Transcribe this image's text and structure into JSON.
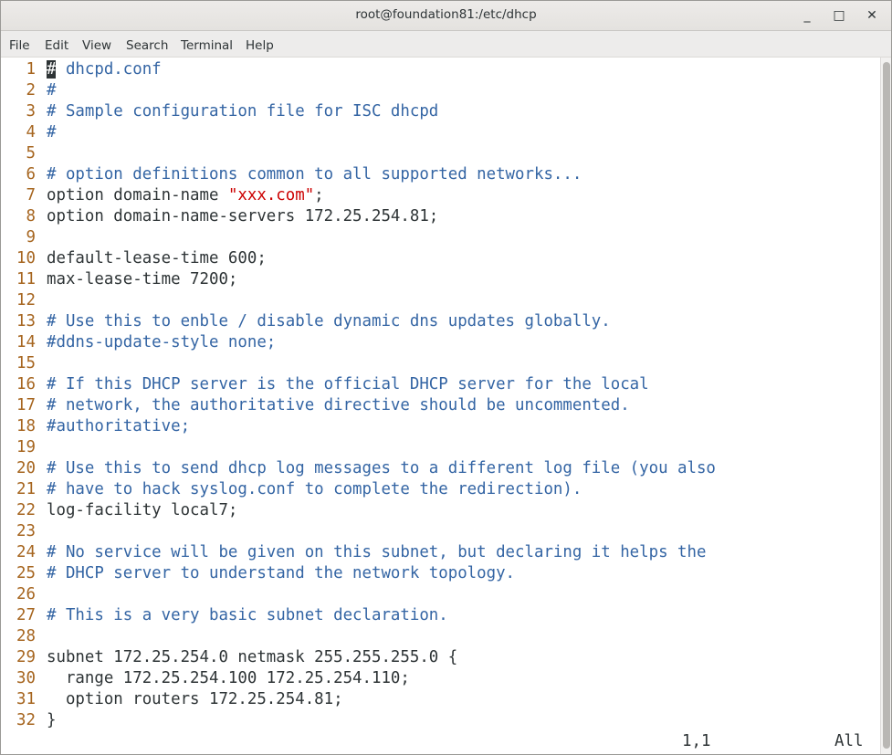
{
  "window": {
    "title": "root@foundation81:/etc/dhcp"
  },
  "window_controls": {
    "minimize": "_",
    "maximize": "□",
    "close": "✕"
  },
  "menu": [
    "File",
    "Edit",
    "View",
    "Search",
    "Terminal",
    "Help"
  ],
  "editor": {
    "lines": [
      {
        "n": "1",
        "t": "c",
        "text": "# dhcpd.conf"
      },
      {
        "n": "2",
        "t": "c",
        "text": "#"
      },
      {
        "n": "3",
        "t": "c",
        "text": "# Sample configuration file for ISC dhcpd"
      },
      {
        "n": "4",
        "t": "c",
        "text": "#"
      },
      {
        "n": "5",
        "t": "n",
        "text": ""
      },
      {
        "n": "6",
        "t": "c",
        "text": "# option definitions common to all supported networks..."
      },
      {
        "n": "7",
        "t": "s",
        "text": "option domain-name ",
        "str": "\"xxx.com\"",
        "after": ";"
      },
      {
        "n": "8",
        "t": "n",
        "text": "option domain-name-servers 172.25.254.81;"
      },
      {
        "n": "9",
        "t": "n",
        "text": ""
      },
      {
        "n": "10",
        "t": "n",
        "text": "default-lease-time 600;"
      },
      {
        "n": "11",
        "t": "n",
        "text": "max-lease-time 7200;"
      },
      {
        "n": "12",
        "t": "n",
        "text": ""
      },
      {
        "n": "13",
        "t": "c",
        "text": "# Use this to enble / disable dynamic dns updates globally."
      },
      {
        "n": "14",
        "t": "c",
        "text": "#ddns-update-style none;"
      },
      {
        "n": "15",
        "t": "n",
        "text": ""
      },
      {
        "n": "16",
        "t": "c",
        "text": "# If this DHCP server is the official DHCP server for the local"
      },
      {
        "n": "17",
        "t": "c",
        "text": "# network, the authoritative directive should be uncommented."
      },
      {
        "n": "18",
        "t": "c",
        "text": "#authoritative;"
      },
      {
        "n": "19",
        "t": "n",
        "text": ""
      },
      {
        "n": "20",
        "t": "c",
        "text": "# Use this to send dhcp log messages to a different log file (you also"
      },
      {
        "n": "21",
        "t": "c",
        "text": "# have to hack syslog.conf to complete the redirection)."
      },
      {
        "n": "22",
        "t": "n",
        "text": "log-facility local7;"
      },
      {
        "n": "23",
        "t": "n",
        "text": ""
      },
      {
        "n": "24",
        "t": "c",
        "text": "# No service will be given on this subnet, but declaring it helps the"
      },
      {
        "n": "25",
        "t": "c",
        "text": "# DHCP server to understand the network topology."
      },
      {
        "n": "26",
        "t": "n",
        "text": ""
      },
      {
        "n": "27",
        "t": "c",
        "text": "# This is a very basic subnet declaration."
      },
      {
        "n": "28",
        "t": "n",
        "text": ""
      },
      {
        "n": "29",
        "t": "n",
        "text": "subnet 172.25.254.0 netmask 255.255.255.0 {"
      },
      {
        "n": "30",
        "t": "n",
        "text": "  range 172.25.254.100 172.25.254.110;"
      },
      {
        "n": "31",
        "t": "n",
        "text": "  option routers 172.25.254.81;"
      },
      {
        "n": "32",
        "t": "n",
        "text": "}"
      }
    ],
    "status_position": "1,1",
    "status_scroll": "All"
  },
  "colors": {
    "comment": "#3465a4",
    "string": "#cc0000",
    "line_number": "#a6651f",
    "text": "#2e3436"
  }
}
